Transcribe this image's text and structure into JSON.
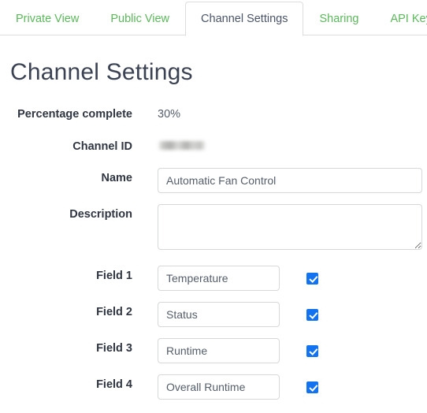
{
  "tabs": [
    {
      "label": "Private View",
      "active": false
    },
    {
      "label": "Public View",
      "active": false
    },
    {
      "label": "Channel Settings",
      "active": true
    },
    {
      "label": "Sharing",
      "active": false
    },
    {
      "label": "API Keys",
      "active": false
    }
  ],
  "page": {
    "title": "Channel Settings"
  },
  "form": {
    "percentage_complete": {
      "label": "Percentage complete",
      "value": "30%"
    },
    "channel_id": {
      "label": "Channel ID",
      "value": "",
      "redacted": true
    },
    "name": {
      "label": "Name",
      "value": "Automatic Fan Control",
      "placeholder": ""
    },
    "description": {
      "label": "Description",
      "value": "",
      "placeholder": ""
    },
    "fields": [
      {
        "label": "Field 1",
        "value": "Temperature",
        "checked": true
      },
      {
        "label": "Field 2",
        "value": "Status",
        "checked": true
      },
      {
        "label": "Field 3",
        "value": "Runtime",
        "checked": true
      },
      {
        "label": "Field 4",
        "value": "Overall Runtime",
        "checked": true
      }
    ]
  },
  "colors": {
    "tab_link": "#5cb85c",
    "tab_active_text": "#4a5568",
    "checkbox_blue": "#1272f0",
    "heading": "#3a4253",
    "border": "#dddddd"
  }
}
